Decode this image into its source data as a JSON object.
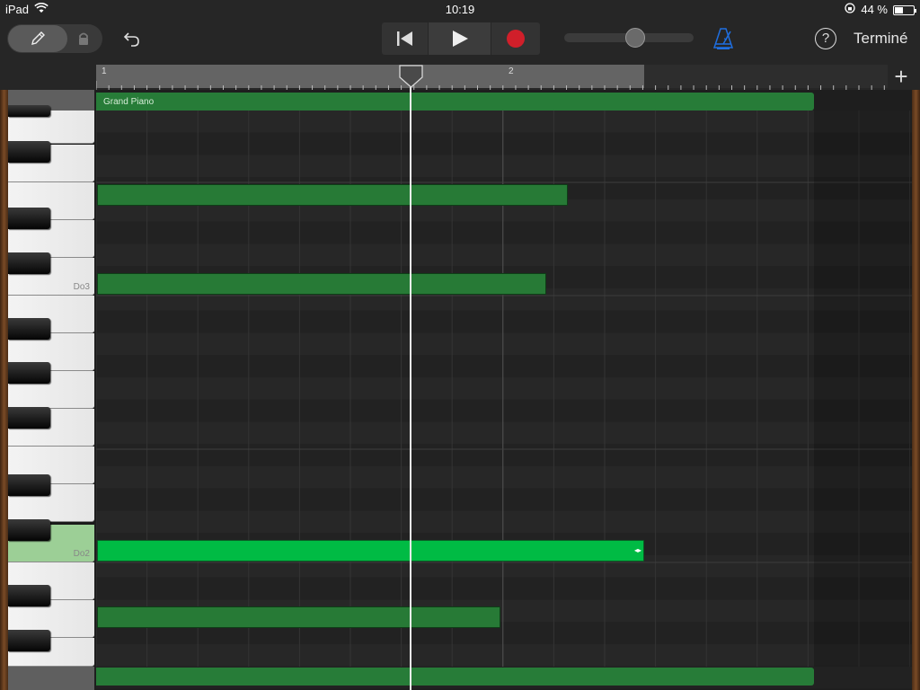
{
  "status_bar": {
    "carrier": "iPad",
    "time": "10:19",
    "battery_text": "44 %",
    "battery_level": 0.44
  },
  "toolbar": {
    "done_label": "Terminé",
    "help_label": "?",
    "volume_level": 0.55,
    "metronome_color": "#1f6fe0"
  },
  "ruler": {
    "markers": [
      "1",
      "2"
    ]
  },
  "region": {
    "name": "Grand Piano",
    "color": "#277c38"
  },
  "keyboard": {
    "labels": [
      "Do3",
      "Do2"
    ]
  },
  "notes_color": "#277a36",
  "selected_note_color": "#00bb44"
}
